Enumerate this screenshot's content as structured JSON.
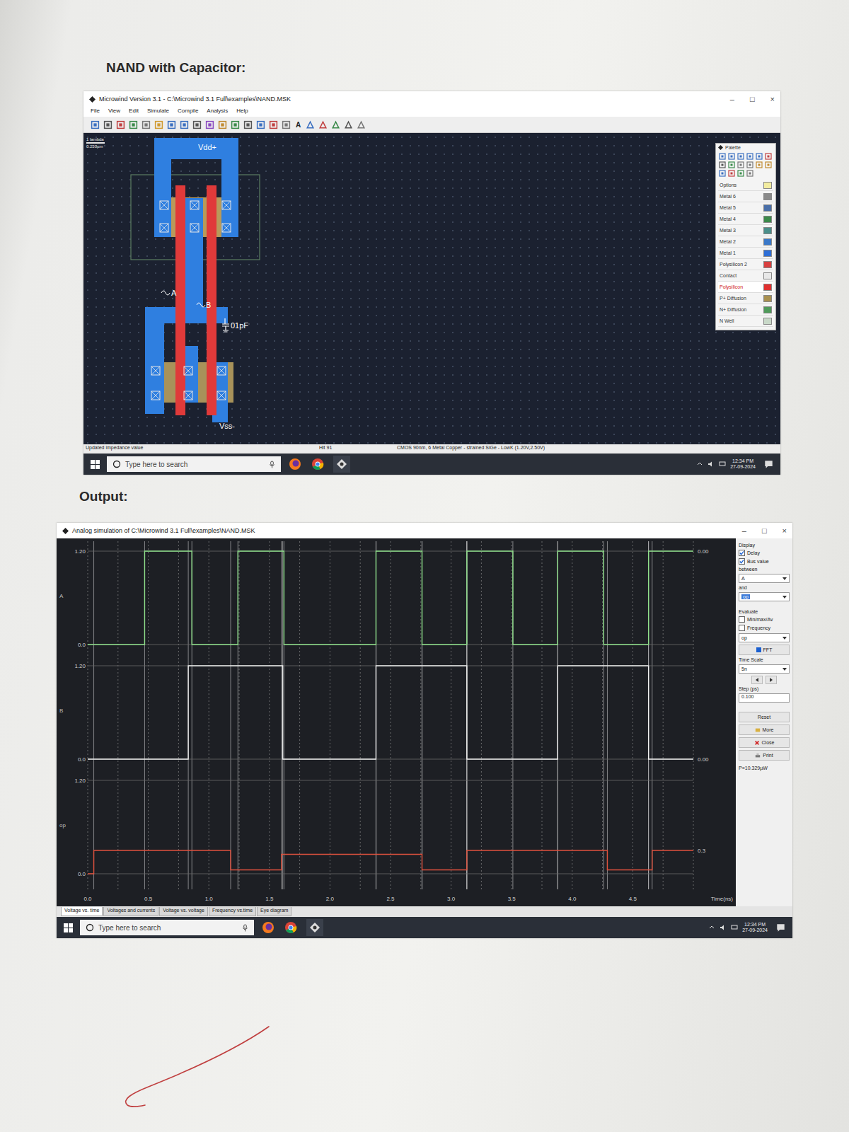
{
  "page": {
    "heading": "NAND with Capacitor:",
    "output_heading": "Output:"
  },
  "editor": {
    "title": "Microwind Version 3.1 - C:\\Microwind 3.1 Full\\examples\\NAND.MSK",
    "window_buttons": [
      "–",
      "□",
      "×"
    ],
    "menu": [
      "File",
      "View",
      "Edit",
      "Simulate",
      "Compile",
      "Analysis",
      "Help"
    ],
    "toolbar_text": "A",
    "scale": {
      "unit": "1 lambda",
      "length": "0.250µm"
    },
    "layout_labels": {
      "vdd": "Vdd+",
      "a": "A",
      "b": "B",
      "capacitor": "01pF",
      "vss": "Vss-"
    },
    "palette": {
      "title": "Palette",
      "layers": [
        {
          "name": "Options",
          "color": "#f2eca0",
          "selected": false
        },
        {
          "name": "Metal 6",
          "color": "#8a8a8a",
          "selected": false
        },
        {
          "name": "Metal 5",
          "color": "#4a6fa8",
          "selected": false
        },
        {
          "name": "Metal 4",
          "color": "#3c8a4a",
          "selected": false
        },
        {
          "name": "Metal 3",
          "color": "#4b8f8a",
          "selected": false
        },
        {
          "name": "Metal 2",
          "color": "#3a78c8",
          "selected": false
        },
        {
          "name": "Metal 1",
          "color": "#2f6fd6",
          "selected": false
        },
        {
          "name": "Polysilicon 2",
          "color": "#d84040",
          "selected": false
        },
        {
          "name": "Contact",
          "color": "#e8e8e8",
          "selected": false
        },
        {
          "name": "Polysilicon",
          "color": "#e03030",
          "selected": true
        },
        {
          "name": "P+ Diffusion",
          "color": "#a89050",
          "selected": false
        },
        {
          "name": "N+ Diffusion",
          "color": "#4f9a5a",
          "selected": false
        },
        {
          "name": "N Well",
          "color": "#c8d8c8",
          "selected": false
        }
      ]
    },
    "status": {
      "message": "Updated impedance value",
      "hit": "Hit 91",
      "technology": "CMOS 90nm, 6 Metal Copper - strained SiGe - LowK (1.20V,2.50V)"
    },
    "taskbar": {
      "search": "Type here to search",
      "time": "12:34 PM",
      "date": "27-09-2024"
    }
  },
  "simulation": {
    "title": "Analog simulation of C:\\Microwind 3.1 Full\\examples\\NAND.MSK",
    "window_buttons": [
      "–",
      "□",
      "×"
    ],
    "x_ticks": [
      "0.0",
      "0.5",
      "1.0",
      "1.5",
      "2.0",
      "2.5",
      "3.0",
      "3.5",
      "4.0",
      "4.5"
    ],
    "x_unit": "Time(ns)",
    "series": [
      {
        "name": "A",
        "color": "#8fe08a",
        "y_max": "1.20",
        "y_min": "0.0",
        "end_value": "0.00",
        "t": [
          0,
          0.47,
          0.86,
          1.24,
          1.62,
          2.38,
          2.76,
          3.13,
          3.51,
          3.88,
          4.26,
          4.63
        ],
        "v": [
          0,
          1.2,
          0,
          1.2,
          0,
          1.2,
          0,
          1.2,
          0,
          1.2,
          0,
          1.2
        ]
      },
      {
        "name": "B",
        "color": "#f0f0f0",
        "y_max": "1.20",
        "y_min": "0.0",
        "end_value": "0.00",
        "t": [
          0,
          0.83,
          1.61,
          2.38,
          3.13,
          3.88,
          4.63
        ],
        "v": [
          0,
          1.2,
          0,
          1.2,
          0,
          1.2,
          0
        ]
      },
      {
        "name": "op",
        "color": "#e0523e",
        "y_max": "1.20",
        "y_min": "0.0",
        "end_value": "0.3",
        "t": [
          0,
          0.05,
          1.18,
          1.6,
          2.76,
          3.13,
          4.29,
          4.66
        ],
        "v": [
          0,
          0.3,
          0.05,
          0.25,
          0.05,
          0.3,
          0.05,
          0.3
        ]
      }
    ],
    "panel": {
      "display": "Display",
      "display_checks": [
        {
          "label": "Delay",
          "checked": true
        },
        {
          "label": "Bus value",
          "checked": true
        }
      ],
      "between": "between",
      "from": "A",
      "and": "and",
      "to": "op",
      "evaluate": "Evaluate",
      "evaluate_checks": [
        {
          "label": "Min/max/Av",
          "checked": false
        },
        {
          "label": "Frequency",
          "checked": false
        }
      ],
      "evaluate_signal": "op",
      "fft": "FFT",
      "time_scale_label": "Time Scale",
      "time_scale": "5n",
      "step_label": "Step (ps)",
      "step": "0.100",
      "buttons": [
        "Reset",
        "More",
        "Close",
        "Print"
      ],
      "power": "P=10.329µW"
    },
    "tabs": [
      {
        "label": "Voltage vs. time",
        "selected": true
      },
      {
        "label": "Voltages and currents",
        "selected": false
      },
      {
        "label": "Voltage vs. voltage",
        "selected": false
      },
      {
        "label": "Frequency vs.time",
        "selected": false
      },
      {
        "label": "Eye diagram",
        "selected": false
      }
    ],
    "taskbar": {
      "search": "Type here to search",
      "time": "12:34 PM",
      "date": "27-09-2024"
    }
  }
}
